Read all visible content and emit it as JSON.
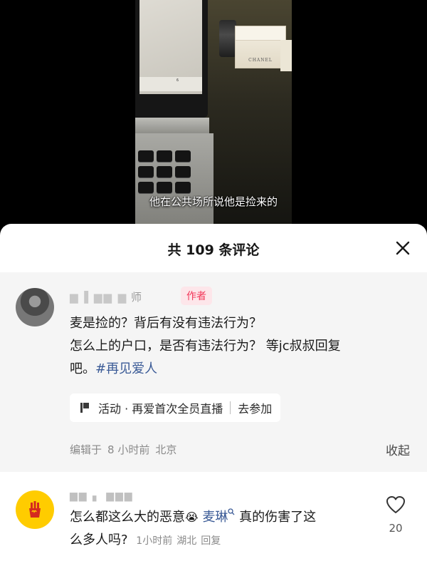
{
  "video": {
    "subtitle": "他在公共场所说他是捡来的",
    "box_label": "CHANEL",
    "screen_clock": "6"
  },
  "sheet": {
    "title": "共 109 条评论",
    "close_icon": "close-icon"
  },
  "author_comment": {
    "name_visible": "师",
    "badge": "作者",
    "text_line1": "麦是捡的？背后有没有违法行为？",
    "text_line2": "怎么上的户口，是否有违法行为？ 等jc叔叔回复",
    "text_line3": "吧。",
    "hashtag": "#再见爱人",
    "activity": {
      "label": "活动 · 再爱首次全员直播",
      "action": "去参加"
    },
    "meta": {
      "edited": "编辑于",
      "time": "8 小时前",
      "location": "北京"
    },
    "collapse_label": "收起"
  },
  "comment2": {
    "text_part1": "怎么都这么大的恶意",
    "emoji": "😭",
    "mention": "麦琳",
    "text_part2": " 真的伤害了这",
    "text_line2": "么多人吗?",
    "meta": {
      "time": "1小时前",
      "location": "湖北",
      "reply": "回复"
    },
    "like_count": "20"
  },
  "colors": {
    "sheet_bg": "#ffffff",
    "author_block_bg": "#f5f5f5",
    "badge_bg": "#fde6ea",
    "badge_text": "#f2385a",
    "link": "#3a5a96",
    "avatar_mc": "#ffcc00"
  }
}
